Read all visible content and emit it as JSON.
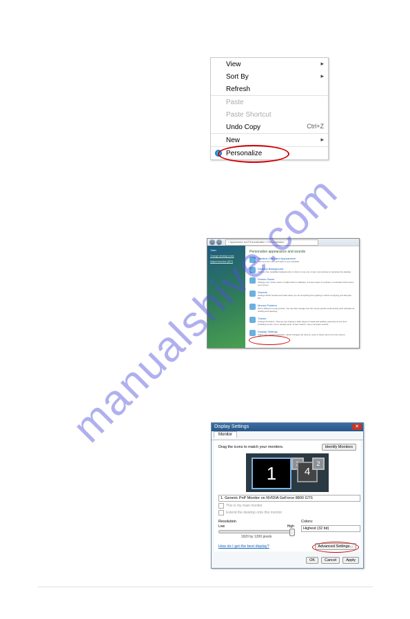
{
  "watermark": "manualshive.com",
  "contextMenu": {
    "view": "View",
    "sortBy": "Sort By",
    "refresh": "Refresh",
    "paste": "Paste",
    "pasteShortcut": "Paste Shortcut",
    "undoCopy": "Undo Copy",
    "undoShortcut": "Ctrl+Z",
    "new": "New",
    "personalize": "Personalize"
  },
  "personalization": {
    "address": "« Appearance and Personalization » Personalization",
    "sidebar": {
      "header": "Tasks",
      "item1": "Change desktop icons",
      "item2": "Adjust font size (DPI)"
    },
    "heading": "Personalize appearance and sounds",
    "items": [
      {
        "title": "Window Color and Appearance",
        "desc": "Fine tune the color and style of your windows."
      },
      {
        "title": "Desktop Background",
        "desc": "Choose from available backgrounds or colors or use one of your own pictures to decorate the desktop."
      },
      {
        "title": "Screen Saver",
        "desc": "Change your screen saver or adjust when it displays. A screen saver is a picture or animation that covers your screen."
      },
      {
        "title": "Sounds",
        "desc": "Change which sounds are heard when you do everything from getting e-mail to emptying your Recycle Bin."
      },
      {
        "title": "Mouse Pointers",
        "desc": "Pick a different mouse pointer. You can also change how the mouse pointer looks during such activities as clicking and selecting."
      },
      {
        "title": "Theme",
        "desc": "Change the theme. Themes can change a wide range of visual and auditory elements at one time including menus, icons, backgrounds, screen savers, some computer sounds."
      },
      {
        "title": "Display Settings",
        "desc": "Adjust your monitor resolution, which changes the view so more or fewer items fit on the screen."
      }
    ]
  },
  "displaySettings": {
    "title": "Display Settings",
    "tab": "Monitor",
    "drag": "Drag the icons to match your monitors.",
    "identify": "Identify Monitors",
    "m1": "1",
    "m2": "2",
    "m3": "3",
    "m4": "4",
    "monitorSel": "1. Generic PnP Monitor on NVIDIA GeForce 8800 GTS",
    "cb1": "This is my main monitor",
    "cb2": "Extend the desktop onto this monitor",
    "resolution": "Resolution",
    "low": "Low",
    "high": "High",
    "current": "1920 by 1200 pixels",
    "colors": "Colors:",
    "colorSel": "Highest (32 bit)",
    "helpLink": "How do I get the best display?",
    "advanced": "Advanced Settings...",
    "ok": "OK",
    "cancel": "Cancel",
    "apply": "Apply"
  }
}
